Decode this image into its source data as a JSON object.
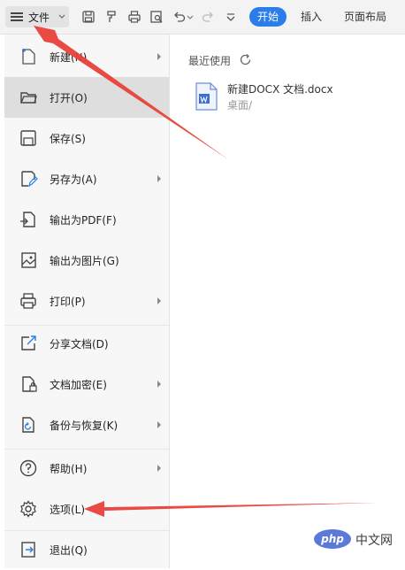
{
  "toolbar": {
    "file_label": "文件",
    "tabs": [
      "开始",
      "插入",
      "页面布局"
    ],
    "active_tab_color": "#2b7de9"
  },
  "menu": {
    "items": [
      {
        "label": "新建(N)",
        "icon": "new-doc-icon",
        "submenu": true
      },
      {
        "label": "打开(O)",
        "icon": "folder-open-icon",
        "submenu": false,
        "selected": true
      },
      {
        "label": "保存(S)",
        "icon": "save-icon",
        "submenu": false
      },
      {
        "label": "另存为(A)",
        "icon": "save-as-icon",
        "submenu": true
      },
      {
        "label": "输出为PDF(F)",
        "icon": "export-pdf-icon",
        "submenu": false
      },
      {
        "label": "输出为图片(G)",
        "icon": "export-image-icon",
        "submenu": false
      },
      {
        "label": "打印(P)",
        "icon": "printer-icon",
        "submenu": true
      },
      {
        "label": "分享文档(D)",
        "icon": "share-icon",
        "submenu": false
      },
      {
        "label": "文档加密(E)",
        "icon": "encrypt-doc-icon",
        "submenu": true
      },
      {
        "label": "备份与恢复(K)",
        "icon": "backup-icon",
        "submenu": true
      },
      {
        "label": "帮助(H)",
        "icon": "help-icon",
        "submenu": true
      },
      {
        "label": "选项(L)",
        "icon": "gear-icon",
        "submenu": false
      },
      {
        "label": "退出(Q)",
        "icon": "exit-icon",
        "submenu": false
      }
    ]
  },
  "recent": {
    "title": "最近使用",
    "files": [
      {
        "name": "新建DOCX 文档.docx",
        "path": "桌面/"
      }
    ]
  },
  "watermark": {
    "badge": "php",
    "text": "中文网"
  },
  "annotation_color": "#e8413a"
}
